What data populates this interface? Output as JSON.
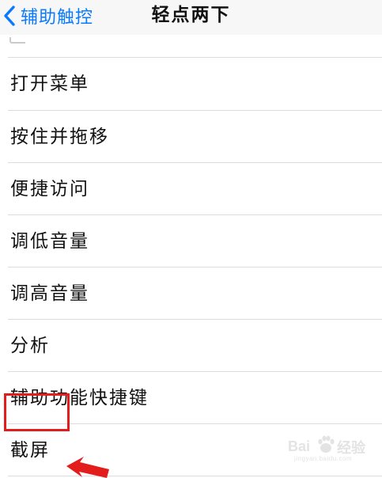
{
  "nav": {
    "back_label": "辅助触控",
    "title": "轻点两下",
    "accent_color": "#0a7aff",
    "back_icon": "chevron-left-icon"
  },
  "menu": {
    "items": [
      {
        "label": "打开菜单"
      },
      {
        "label": "按住并拖移"
      },
      {
        "label": "便捷访问"
      },
      {
        "label": "调低音量"
      },
      {
        "label": "调高音量"
      },
      {
        "label": "分析"
      },
      {
        "label": "辅助功能快捷键"
      },
      {
        "label": "截屏"
      }
    ]
  },
  "annotation": {
    "highlight_color": "#e31c1c",
    "highlighted_item": "截屏",
    "arrow_icon": "red-arrow-icon"
  },
  "watermark": {
    "brand_left": "Bai",
    "brand_right": "经验",
    "url": "jingyan.baidu.com",
    "icon": "baidu-paw-icon"
  }
}
